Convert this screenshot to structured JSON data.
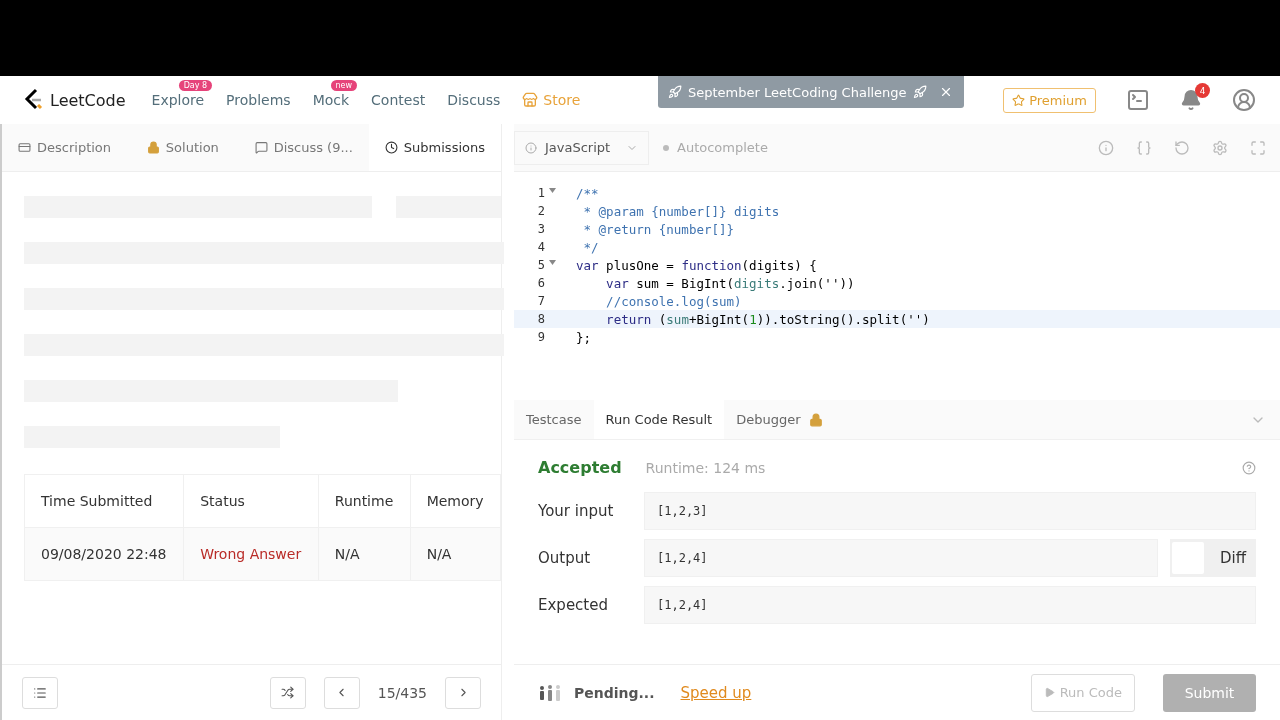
{
  "navbar": {
    "logo": "LeetCode",
    "items": [
      {
        "label": "Explore",
        "badge": "Day 8",
        "kind": "link"
      },
      {
        "label": "Problems",
        "kind": "link"
      },
      {
        "label": "Mock",
        "badge": "new",
        "kind": "link"
      },
      {
        "label": "Contest",
        "kind": "link"
      },
      {
        "label": "Discuss",
        "kind": "link"
      },
      {
        "label": "Store",
        "kind": "store"
      }
    ],
    "banner": {
      "text": "September LeetCoding Challenge"
    },
    "premium": "Premium",
    "notifications": "4"
  },
  "left_tabs": [
    {
      "label": "Description",
      "selected": false
    },
    {
      "label": "Solution",
      "selected": false
    },
    {
      "label": "Discuss (9...",
      "selected": false
    },
    {
      "label": "Submissions",
      "selected": true
    }
  ],
  "editor_toolbar": {
    "language": "JavaScript",
    "autocomplete": {
      "label": "Autocomplete",
      "on": false
    }
  },
  "code": [
    {
      "number": "1",
      "foldable": true,
      "active": false,
      "tokens": [
        {
          "kind": "comment",
          "text": "/**"
        }
      ]
    },
    {
      "number": "2",
      "foldable": false,
      "active": false,
      "tokens": [
        {
          "kind": "comment",
          "text": " * @param {number[]} digits"
        }
      ]
    },
    {
      "number": "3",
      "foldable": false,
      "active": false,
      "tokens": [
        {
          "kind": "comment",
          "text": " * @return {number[]}"
        }
      ]
    },
    {
      "number": "4",
      "foldable": false,
      "active": false,
      "tokens": [
        {
          "kind": "comment",
          "text": " */"
        }
      ]
    },
    {
      "number": "5",
      "foldable": true,
      "active": false,
      "tokens": [
        {
          "kind": "keyword",
          "text": "var"
        },
        {
          "kind": "plain",
          "text": " plusOne = "
        },
        {
          "kind": "keyword",
          "text": "function"
        },
        {
          "kind": "plain",
          "text": "(digits) {"
        }
      ]
    },
    {
      "number": "6",
      "foldable": false,
      "active": false,
      "tokens": [
        {
          "kind": "keyword",
          "text": "    var"
        },
        {
          "kind": "plain",
          "text": " sum = BigInt("
        },
        {
          "kind": "variable",
          "text": "digits"
        },
        {
          "kind": "plain",
          "text": ".join('"
        },
        {
          "kind": "plain",
          "text": "'))"
        }
      ]
    },
    {
      "number": "7",
      "foldable": false,
      "active": false,
      "tokens": [
        {
          "kind": "comment",
          "text": "    //console.log(sum)"
        }
      ]
    },
    {
      "number": "8",
      "foldable": false,
      "active": true,
      "tokens": [
        {
          "kind": "keyword",
          "text": "    return"
        },
        {
          "kind": "plain",
          "text": " ("
        },
        {
          "kind": "variable",
          "text": "sum"
        },
        {
          "kind": "plain",
          "text": "+BigInt("
        },
        {
          "kind": "number",
          "text": "1"
        },
        {
          "kind": "plain",
          "text": ")).toString().split('')"
        }
      ]
    },
    {
      "number": "9",
      "foldable": false,
      "active": false,
      "tokens": [
        {
          "kind": "plain",
          "text": "};"
        }
      ]
    }
  ],
  "result_tabs": [
    {
      "label": "Testcase",
      "locked": false,
      "selected": false
    },
    {
      "label": "Run Code Result",
      "locked": false,
      "selected": true
    },
    {
      "label": "Debugger",
      "locked": true,
      "selected": false
    }
  ],
  "result": {
    "status": "Accepted",
    "runtime": "Runtime: 124 ms",
    "rows": [
      {
        "label": "Your input",
        "value": "[1,2,3]"
      },
      {
        "label": "Output",
        "value": "[1,2,4]",
        "diff": {
          "label": "Diff",
          "on": false
        }
      },
      {
        "label": "Expected",
        "value": "[1,2,4]"
      }
    ]
  },
  "submissions": {
    "columns": [
      "Time Submitted",
      "Status",
      "Runtime",
      "Memory"
    ],
    "rows": [
      {
        "cells": [
          "09/08/2020 22:48",
          "Wrong Answer",
          "N/A",
          "N/A"
        ],
        "color": "#b92b27"
      }
    ]
  },
  "footer": {
    "page": "15/435",
    "pending": "Pending...",
    "speed_up": "Speed up",
    "run_code": {
      "label": "Run Code",
      "disabled": true
    },
    "submit": {
      "label": "Submit",
      "disabled": true
    }
  }
}
